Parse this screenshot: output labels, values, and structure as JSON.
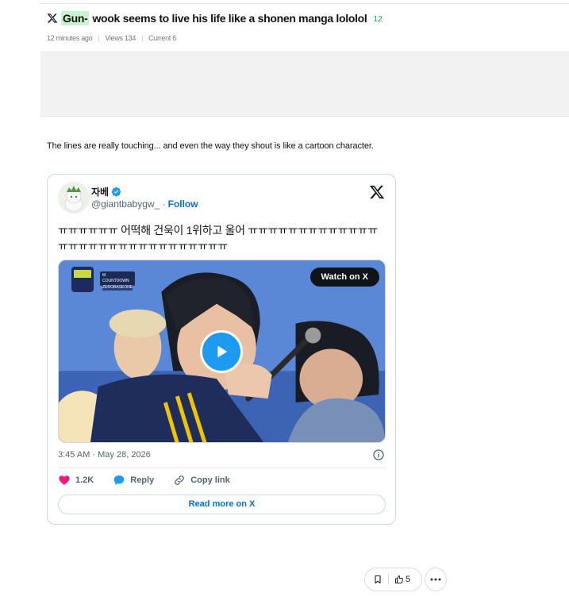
{
  "post": {
    "title_highlight": "Gun-",
    "title_rest": "wook seems to live his life like a shonen manga lololol",
    "comment_count": "12",
    "meta": {
      "time": "12 minutes ago",
      "views": "Views 134",
      "current": "Current 6"
    },
    "body": "The lines are really touching... and even the way they shout is like a cartoon character."
  },
  "tweet": {
    "author_name": "자베",
    "handle": "@giantbabygw_",
    "follow_label": "Follow",
    "text": "ㅠㅠㅠㅠㅠㅠ 어떡해 건욱이 1위하고 울어 ㅠㅠㅠㅠㅠㅠㅠㅠㅠㅠㅠㅠㅠㅠㅠㅠㅠㅠㅠㅠㅠㅠㅠㅠㅠㅠㅠㅠㅠㅠ",
    "watch_label": "Watch on X",
    "media_tags": [
      "M COUNTDOWN",
      "ZEROBASEONE"
    ],
    "timestamp": "3:45 AM · May 28, 2026",
    "likes": "1.2K",
    "reply_label": "Reply",
    "copy_label": "Copy link",
    "read_more_label": "Read more on X"
  },
  "footer": {
    "like_count": "5"
  },
  "colors": {
    "highlight": "#c9f2cf",
    "link_blue": "#006fd6",
    "x_blue": "#1d9bf0",
    "heart": "#f91880",
    "count_green": "#22a34a"
  }
}
